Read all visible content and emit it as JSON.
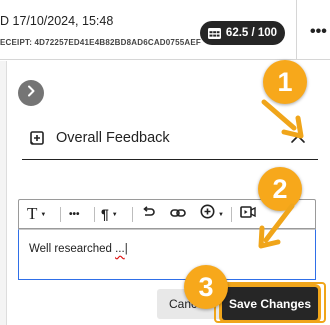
{
  "header": {
    "submitted_text": "D 17/10/2024, 15:48",
    "receipt_text": "ECEIPT: 4D72257ED41E4B82BD8AD6CAD0755AEF",
    "grade_text": "62.5 / 100",
    "grade_icon": "table-grid-icon",
    "more_label": "•••"
  },
  "panel": {
    "collapse_icon": "chevron-right-icon",
    "feedback_section": {
      "title": "Overall Feedback",
      "icon": "feedback-plus-icon",
      "toggle_icon": "chevron-up-icon"
    },
    "editor": {
      "toolbar": [
        {
          "name": "text-style",
          "label": "T"
        },
        {
          "name": "more-formatting",
          "label": "•••"
        },
        {
          "name": "paragraph",
          "label": "¶"
        },
        {
          "name": "undo",
          "label": ""
        },
        {
          "name": "link",
          "label": ""
        },
        {
          "name": "insert",
          "label": ""
        },
        {
          "name": "media",
          "label": ""
        }
      ],
      "content": "Well researched",
      "content_suffix": "...",
      "caret": "|"
    },
    "buttons": {
      "cancel": "Cancel",
      "save": "Save Changes"
    }
  },
  "callouts": [
    "1",
    "2",
    "3"
  ],
  "colors": {
    "accent_callout": "#f7a81b",
    "dark_button": "#262626",
    "focus_border": "#2f6fe8"
  }
}
